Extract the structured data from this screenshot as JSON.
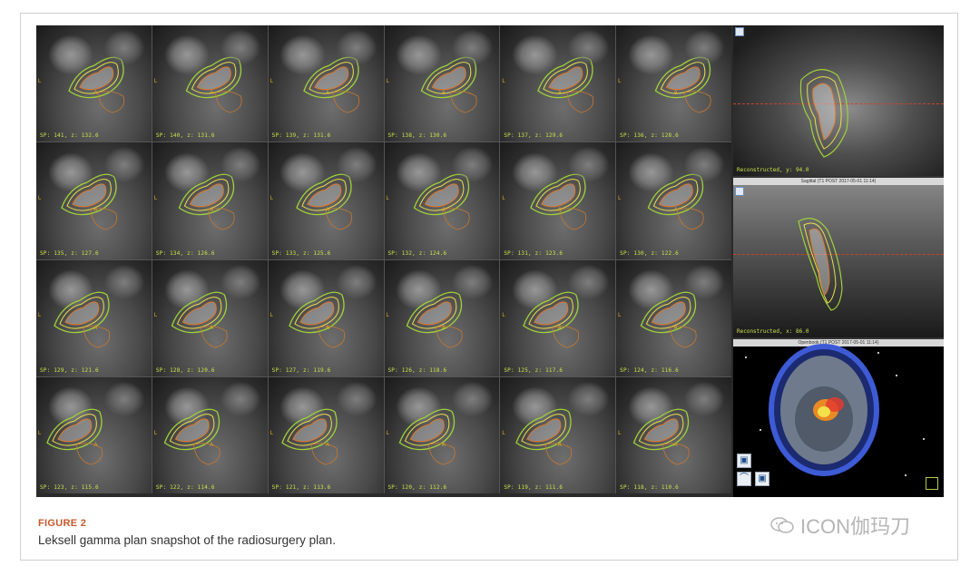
{
  "figure": {
    "slices": [
      {
        "label": "SP: 141, z: 132.6"
      },
      {
        "label": "SP: 140, z: 131.6"
      },
      {
        "label": "SP: 139, z: 131.6"
      },
      {
        "label": "SP: 138, z: 130.6"
      },
      {
        "label": "SP: 137, z: 129.6"
      },
      {
        "label": "SP: 136, z: 128.6"
      },
      {
        "label": "SP: 135, z: 127.6"
      },
      {
        "label": "SP: 134, z: 126.6"
      },
      {
        "label": "SP: 133, z: 125.6"
      },
      {
        "label": "SP: 132, z: 124.6"
      },
      {
        "label": "SP: 131, z: 123.6"
      },
      {
        "label": "SP: 130, z: 122.6"
      },
      {
        "label": "SP: 129, z: 121.6"
      },
      {
        "label": "SP: 128, z: 120.6"
      },
      {
        "label": "SP: 127, z: 119.6"
      },
      {
        "label": "SP: 126, z: 118.6"
      },
      {
        "label": "SP: 125, z: 117.6"
      },
      {
        "label": "SP: 124, z: 116.6"
      },
      {
        "label": "SP: 123, z: 115.6"
      },
      {
        "label": "SP: 122, z: 114.6"
      },
      {
        "label": "SP: 121, z: 113.6"
      },
      {
        "label": "SP: 120, z: 112.6"
      },
      {
        "label": "SP: 119, z: 111.6"
      },
      {
        "label": "SP: 118, z: 110.6"
      }
    ],
    "orientation_marks": {
      "anterior": "A",
      "left": "L"
    },
    "coronal_panel": {
      "recon_label": "Reconstructed, y: 94.0"
    },
    "sagittal_panel": {
      "header": "Sagittal (T1 POST 2017-05-01 11:14)",
      "recon_label": "Reconstructed, x: 86.0"
    },
    "openbook_panel": {
      "header": "Openbook (T1 POST 2017-05-01 11:14)"
    },
    "colors": {
      "contour_outer": "#9fd23a",
      "contour_inner": "#e8e04a",
      "target": "#d9782e",
      "slice_text": "#cde14a"
    }
  },
  "caption": {
    "title": "FIGURE 2",
    "text": "Leksell gamma plan snapshot of the radiosurgery plan."
  },
  "watermark": {
    "icon": "wechat-icon",
    "text": "ICON伽玛刀"
  }
}
